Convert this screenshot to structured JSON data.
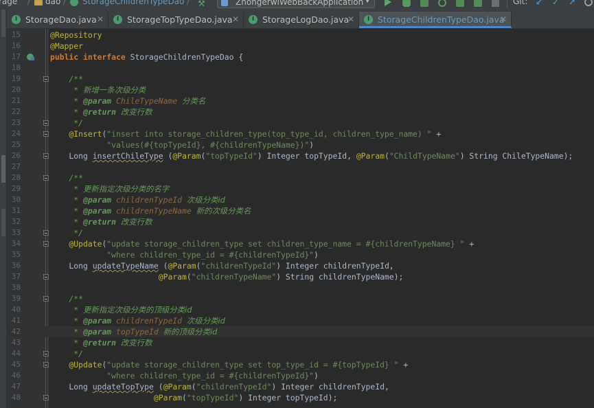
{
  "breadcrumb": {
    "project_fragment": "rage",
    "folder": "dao",
    "file": "StorageChildrenTypeDao"
  },
  "toolbar": {
    "run_config": "ZhongerwiWebBackApplication",
    "vcs_label": "Git:"
  },
  "tabs": [
    {
      "label": "StorageDao.java",
      "active": false
    },
    {
      "label": "StorageTopTypeDao.java",
      "active": false
    },
    {
      "label": "StorageLogDao.java",
      "active": false
    },
    {
      "label": "StorageChildrenTypeDao.java",
      "active": true
    }
  ],
  "editor": {
    "current_line": 42,
    "lines": [
      {
        "n": "15",
        "segs": [
          [
            "ann",
            "@Repository"
          ]
        ]
      },
      {
        "n": "16",
        "segs": [
          [
            "ann",
            "@Mapper"
          ]
        ]
      },
      {
        "n": "17",
        "segs": [
          [
            "kw",
            "public interface "
          ],
          [
            "plain",
            "StorageChildrenTypeDao {"
          ]
        ]
      },
      {
        "n": "18",
        "segs": []
      },
      {
        "n": "19",
        "segs": [
          [
            "doc",
            "    /**"
          ]
        ]
      },
      {
        "n": "20",
        "segs": [
          [
            "doc",
            "     * "
          ],
          [
            "doc cjk",
            "新增一条次级分类"
          ]
        ]
      },
      {
        "n": "21",
        "segs": [
          [
            "doc",
            "     * "
          ],
          [
            "doctag",
            "@param "
          ],
          [
            "docparam",
            "ChileTypeName "
          ],
          [
            "doc cjk",
            "分类名"
          ]
        ]
      },
      {
        "n": "22",
        "segs": [
          [
            "doc",
            "     * "
          ],
          [
            "doctag",
            "@return "
          ],
          [
            "doc cjk",
            "改变行数"
          ]
        ]
      },
      {
        "n": "23",
        "segs": [
          [
            "doc",
            "     */"
          ]
        ]
      },
      {
        "n": "24",
        "segs": [
          [
            "ann",
            "    @Insert"
          ],
          [
            "plain",
            "("
          ],
          [
            "str",
            "\"insert into storage_children_type(top_type_id, children_type_name) \""
          ],
          [
            "plain",
            " +"
          ]
        ]
      },
      {
        "n": "25",
        "segs": [
          [
            "str",
            "            \"values(#{topTypeId}, #{childrenTypeName})\""
          ],
          [
            "plain",
            ")"
          ]
        ]
      },
      {
        "n": "26",
        "segs": [
          [
            "plain",
            "    Long "
          ],
          [
            "meth",
            "insertChileType"
          ],
          [
            "plain",
            " ("
          ],
          [
            "ann",
            "@Param"
          ],
          [
            "plain",
            "("
          ],
          [
            "str",
            "\"topTypeId\""
          ],
          [
            "plain",
            ") "
          ],
          [
            "plain",
            "Integer topTypeId, "
          ],
          [
            "ann",
            "@Param"
          ],
          [
            "plain",
            "("
          ],
          [
            "str",
            "\"ChildTypeName\""
          ],
          [
            "plain",
            ") String ChileTypeName);"
          ]
        ]
      },
      {
        "n": "27",
        "segs": []
      },
      {
        "n": "28",
        "segs": [
          [
            "doc",
            "    /**"
          ]
        ]
      },
      {
        "n": "29",
        "segs": [
          [
            "doc",
            "     * "
          ],
          [
            "doc cjk",
            "更新指定次级分类的名字"
          ]
        ]
      },
      {
        "n": "30",
        "segs": [
          [
            "doc",
            "     * "
          ],
          [
            "doctag",
            "@param "
          ],
          [
            "docparam",
            "childrenTypeId "
          ],
          [
            "doc cjk",
            "次级分类id"
          ]
        ]
      },
      {
        "n": "31",
        "segs": [
          [
            "doc",
            "     * "
          ],
          [
            "doctag",
            "@param "
          ],
          [
            "docparam",
            "childrenTypeName "
          ],
          [
            "doc cjk",
            "新的次级分类名"
          ]
        ]
      },
      {
        "n": "32",
        "segs": [
          [
            "doc",
            "     * "
          ],
          [
            "doctag",
            "@return "
          ],
          [
            "doc cjk",
            "改变行数"
          ]
        ]
      },
      {
        "n": "33",
        "segs": [
          [
            "doc",
            "     */"
          ]
        ]
      },
      {
        "n": "34",
        "segs": [
          [
            "ann",
            "    @Update"
          ],
          [
            "plain",
            "("
          ],
          [
            "str",
            "\"update storage_children_type set children_type_name = #{childrenTypeName} \""
          ],
          [
            "plain",
            " +"
          ]
        ]
      },
      {
        "n": "35",
        "segs": [
          [
            "str",
            "            \"where children_type_id = #{childrenTypeId}\""
          ],
          [
            "plain",
            ")"
          ]
        ]
      },
      {
        "n": "36",
        "segs": [
          [
            "plain",
            "    Long "
          ],
          [
            "meth",
            "updateTypeName"
          ],
          [
            "plain",
            " ("
          ],
          [
            "ann",
            "@Param"
          ],
          [
            "plain",
            "("
          ],
          [
            "str",
            "\"childrenTypeId\""
          ],
          [
            "plain",
            ") Integer childrenTypeId,"
          ]
        ]
      },
      {
        "n": "37",
        "segs": [
          [
            "plain",
            "                       "
          ],
          [
            "ann",
            "@Param"
          ],
          [
            "plain",
            "("
          ],
          [
            "str",
            "\"childrenTypeName\""
          ],
          [
            "plain",
            ") String childrenTypeName);"
          ]
        ]
      },
      {
        "n": "38",
        "segs": []
      },
      {
        "n": "39",
        "segs": [
          [
            "doc",
            "    /**"
          ]
        ]
      },
      {
        "n": "40",
        "segs": [
          [
            "doc",
            "     * "
          ],
          [
            "doc cjk",
            "更新指定次级分类的顶级分类id"
          ]
        ]
      },
      {
        "n": "41",
        "segs": [
          [
            "doc",
            "     * "
          ],
          [
            "doctag",
            "@param "
          ],
          [
            "docparam",
            "childrenTypeId "
          ],
          [
            "doc cjk",
            "次级分类id"
          ]
        ]
      },
      {
        "n": "42",
        "segs": [
          [
            "doc",
            "     * "
          ],
          [
            "doctag",
            "@param "
          ],
          [
            "docparam",
            "topTypeId "
          ],
          [
            "doc cjk",
            "新的顶级分类id"
          ]
        ]
      },
      {
        "n": "43",
        "segs": [
          [
            "doc",
            "     * "
          ],
          [
            "doctag",
            "@return "
          ],
          [
            "doc cjk",
            "改变行数"
          ]
        ]
      },
      {
        "n": "44",
        "segs": [
          [
            "doc",
            "     */"
          ]
        ]
      },
      {
        "n": "45",
        "segs": [
          [
            "ann",
            "    @Update"
          ],
          [
            "plain",
            "("
          ],
          [
            "str",
            "\"update storage_children_type set top_type_id = #{topTypeId} \""
          ],
          [
            "plain",
            " +"
          ]
        ]
      },
      {
        "n": "46",
        "segs": [
          [
            "str",
            "            \"where children_type_id = #{childrenTypeId}\""
          ],
          [
            "plain",
            ")"
          ]
        ]
      },
      {
        "n": "47",
        "segs": [
          [
            "plain",
            "    Long "
          ],
          [
            "meth",
            "updateTopType"
          ],
          [
            "plain",
            " ("
          ],
          [
            "ann",
            "@Param"
          ],
          [
            "plain",
            "("
          ],
          [
            "str",
            "\"childrenTypeId\""
          ],
          [
            "plain",
            ") Integer childrenTypeId,"
          ]
        ]
      },
      {
        "n": "48",
        "segs": [
          [
            "plain",
            "                      "
          ],
          [
            "ann",
            "@Param"
          ],
          [
            "plain",
            "("
          ],
          [
            "str",
            "\"topTypeId\""
          ],
          [
            "plain",
            ") Integer topTypeId);"
          ]
        ]
      }
    ]
  },
  "icons": {
    "run": "run-icon",
    "debug": "debug-icon",
    "coverage": "coverage-icon",
    "profile": "profile-icon",
    "stop": "stop-icon",
    "build": "hammer-icon",
    "vcs_update": "vcs-update-icon",
    "vcs_commit": "vcs-commit-icon",
    "vcs_history": "vcs-history-icon"
  },
  "colors": {
    "editor_bg": "#2b2b2b",
    "annotation": "#bbb529",
    "keyword": "#cc7832",
    "string": "#6a8759",
    "doc": "#629755",
    "doc_param": "#8a653b",
    "active_tab": "#6897bb"
  }
}
